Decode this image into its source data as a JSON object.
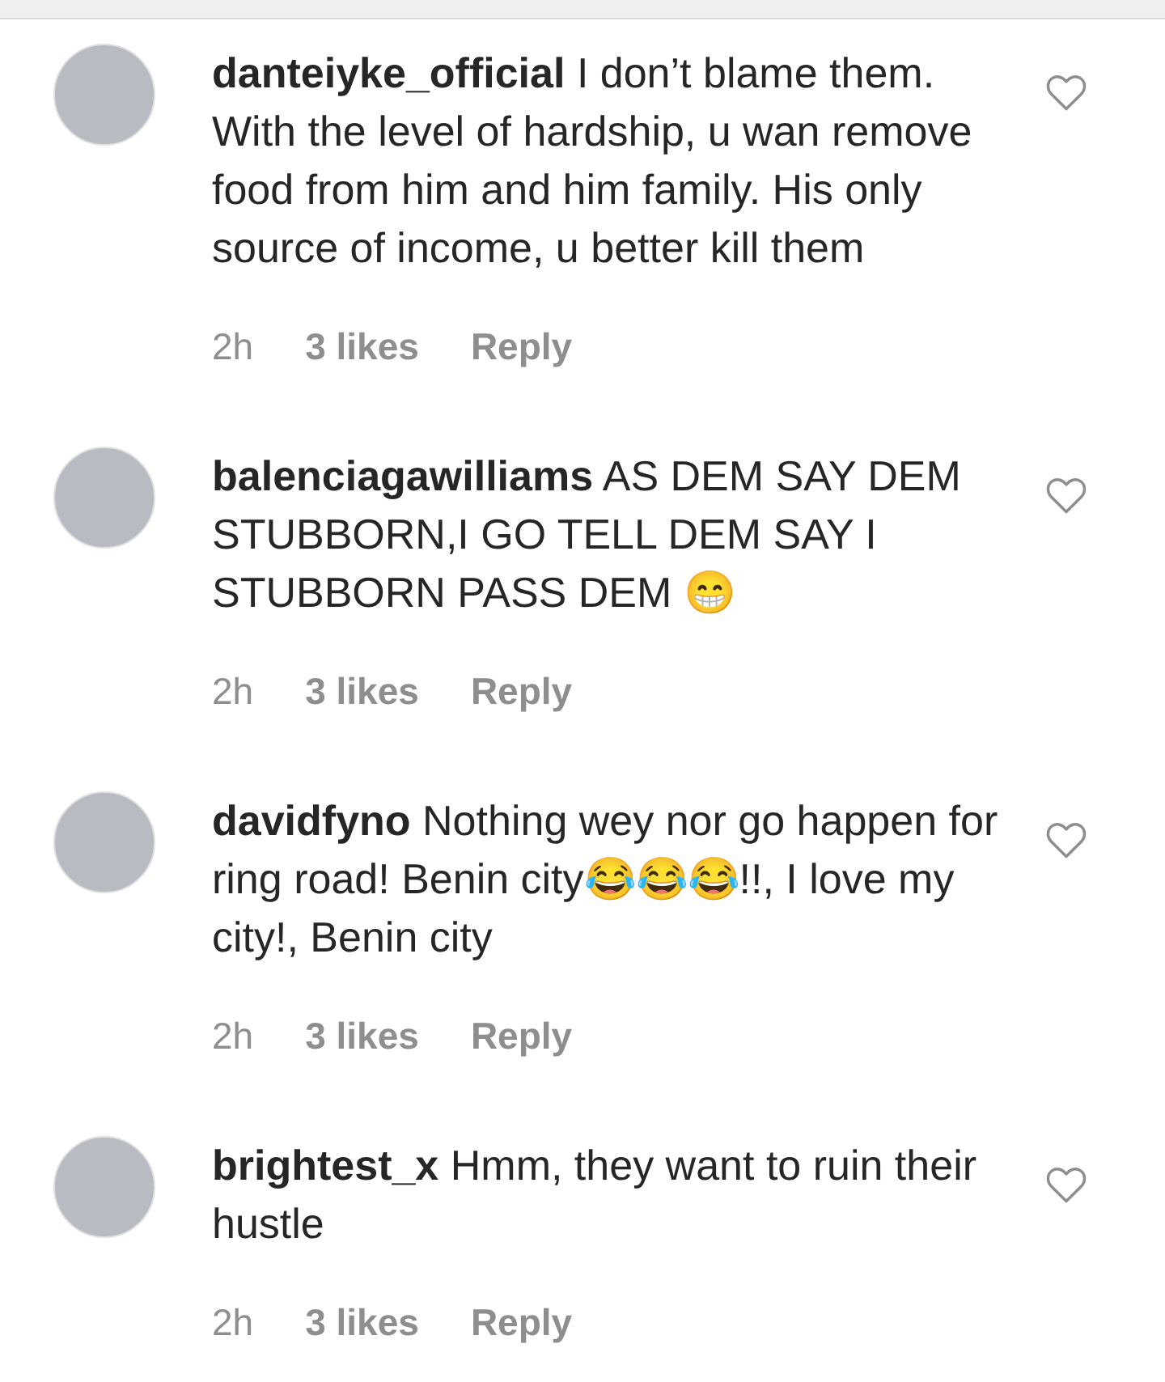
{
  "comments": [
    {
      "username": "danteiyke_official",
      "text": "I don’t blame them. With the level of hardship, u wan remove food from him and him family. His only source of income, u better kill them",
      "time": "2h",
      "likes": "3 likes",
      "reply": "Reply",
      "liked": false
    },
    {
      "username": "balenciagawilliams",
      "text": "AS DEM SAY DEM STUBBORN,I GO TELL DEM SAY I STUBBORN PASS DEM 😁",
      "time": "2h",
      "likes": "3 likes",
      "reply": "Reply",
      "liked": false
    },
    {
      "username": "davidfyno",
      "text": "Nothing wey nor go happen for ring road! Benin city😂😂😂!!, I love my city!, Benin city",
      "time": "2h",
      "likes": "3 likes",
      "reply": "Reply",
      "liked": false
    },
    {
      "username": "brightest_x",
      "text": "Hmm, they want to ruin their hustle",
      "time": "2h",
      "likes": "3 likes",
      "reply": "Reply",
      "liked": false
    }
  ]
}
